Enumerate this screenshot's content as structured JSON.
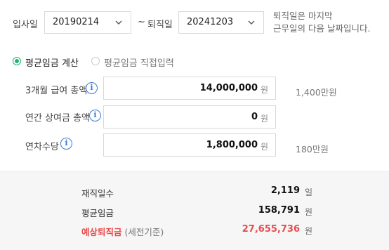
{
  "dates": {
    "start_label": "입사일",
    "start_value": "20190214",
    "separator": "~",
    "end_label": "퇴직일",
    "end_value": "20241203",
    "note_line1": "퇴직일은 마지막",
    "note_line2": "근무일의 다음 날짜입니다."
  },
  "mode": {
    "option1": "평균임금 계산",
    "option2": "평균임금 직접입력",
    "selected": "option1"
  },
  "fields": [
    {
      "label": "3개월 급여 총액",
      "value": "14,000,000",
      "unit": "원",
      "hint": "1,400만원"
    },
    {
      "label": "연간 상여금 총액",
      "value": "0",
      "unit": "원",
      "hint": ""
    },
    {
      "label": "연차수당",
      "value": "1,800,000",
      "unit": "원",
      "hint": "180만원"
    }
  ],
  "results": {
    "days_label": "재직일수",
    "days_value": "2,119",
    "days_unit": "일",
    "avg_label": "평균임금",
    "avg_value": "158,791",
    "avg_unit": "원",
    "sev_label": "예상퇴직금",
    "sev_sub": "(세전기준)",
    "sev_value": "27,655,736",
    "sev_unit": "원"
  },
  "colors": {
    "accent_green": "#22b573",
    "info_blue": "#3a7bd5",
    "highlight_red": "#e84c4c"
  },
  "icons": {
    "dropdown": "chevron-down-icon",
    "info": "info-icon"
  }
}
